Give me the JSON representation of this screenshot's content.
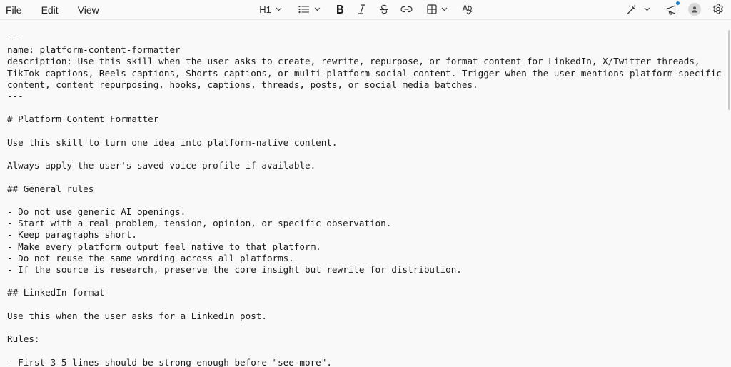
{
  "menu": {
    "file": "File",
    "edit": "Edit",
    "view": "View"
  },
  "toolbar": {
    "heading_value": "H1",
    "icons": {
      "list": "bulleted-list-icon",
      "bold": "bold-icon",
      "italic": "italic-icon",
      "strike": "strikethrough-icon",
      "link": "link-icon",
      "table": "table-icon",
      "spellcheck": "spellcheck-icon",
      "ai": "magic-pen-icon",
      "announce": "megaphone-icon",
      "account": "account-icon",
      "settings": "gear-icon"
    }
  },
  "document": {
    "text": "---\nname: platform-content-formatter\ndescription: Use this skill when the user asks to create, rewrite, repurpose, or format content for LinkedIn, X/Twitter threads, TikTok captions, Reels captions, Shorts captions, or multi-platform social content. Trigger when the user mentions platform-specific content, content repurposing, hooks, captions, threads, posts, or social media batches.\n---\n\n# Platform Content Formatter\n\nUse this skill to turn one idea into platform-native content.\n\nAlways apply the user's saved voice profile if available.\n\n## General rules\n\n- Do not use generic AI openings.\n- Start with a real problem, tension, opinion, or specific observation.\n- Keep paragraphs short.\n- Make every platform output feel native to that platform.\n- Do not reuse the same wording across all platforms.\n- If the source is research, preserve the core insight but rewrite for distribution.\n\n## LinkedIn format\n\nUse this when the user asks for a LinkedIn post.\n\nRules:\n\n- First 3–5 lines should be strong enough before \"see more\".\n- Use short paragraphs."
  },
  "colors": {
    "accent_dot": "#1c7ed6",
    "background": "#f9f9f9"
  }
}
